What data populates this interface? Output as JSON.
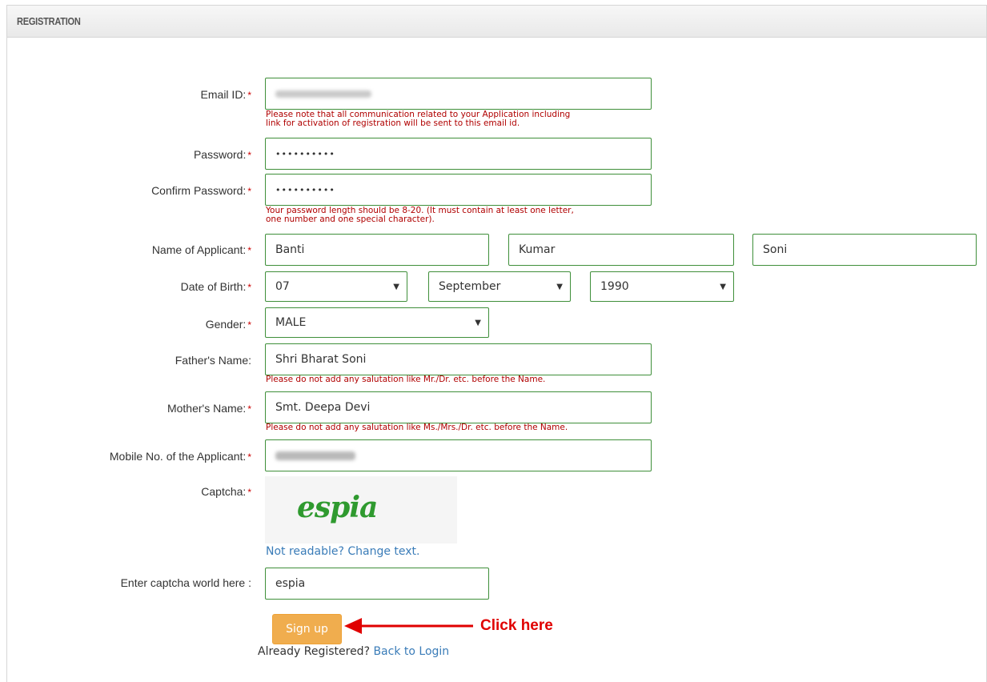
{
  "panel": {
    "title": "REGISTRATION"
  },
  "form": {
    "email": {
      "label": "Email ID:",
      "hint1": "Please note that all communication related to your Application including",
      "hint2": "link for activation of registration will be sent to this email id."
    },
    "password": {
      "label": "Password:",
      "value": "••••••••••"
    },
    "confirm_password": {
      "label": "Confirm Password:",
      "value": "••••••••••",
      "hint1": "Your password length should be 8-20. (It must contain at least one letter,",
      "hint2": "one number and one special character)."
    },
    "name": {
      "label": "Name of Applicant:",
      "first": "Banti",
      "middle": "Kumar",
      "last": "Soni"
    },
    "dob": {
      "label": "Date of Birth:",
      "day": "07",
      "month": "September",
      "year": "1990"
    },
    "gender": {
      "label": "Gender:",
      "value": "MALE"
    },
    "father": {
      "label": "Father's Name:",
      "value": "Shri Bharat Soni",
      "hint": "Please do not add any salutation like Mr./Dr. etc. before the Name."
    },
    "mother": {
      "label": "Mother's Name:",
      "value": "Smt. Deepa Devi",
      "hint": "Please do not add any salutation like Ms./Mrs./Dr. etc. before the Name."
    },
    "mobile": {
      "label": "Mobile No. of the Applicant:"
    },
    "captcha": {
      "label": "Captcha:",
      "image_text": "espia",
      "change_link": "Not readable? Change text."
    },
    "captcha_entry": {
      "label": "Enter captcha world here :",
      "value": "espia"
    },
    "required_marker": "*"
  },
  "actions": {
    "signup_label": "Sign up",
    "annotation": "Click here",
    "already_text": "Already Registered?",
    "back_link": "Back to Login"
  },
  "colors": {
    "field_border": "#3f8f3a",
    "hint": "#b00000",
    "button": "#f0ad4e",
    "annotation": "#e00000",
    "link": "#3a7cb8"
  }
}
